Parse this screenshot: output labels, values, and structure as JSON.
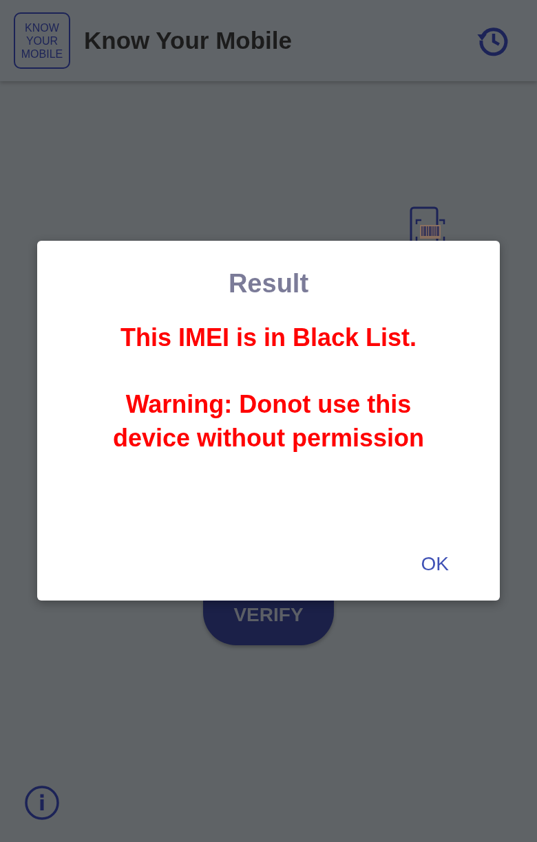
{
  "app_bar": {
    "logo_lines": [
      "KNOW",
      "YOUR",
      "MOBILE"
    ],
    "title": "Know Your Mobile"
  },
  "verify_button": {
    "label": "VERIFY"
  },
  "dialog": {
    "title": "Result",
    "messages": [
      "This IMEI is in Black List.",
      "Warning: Donot use this device without permission"
    ],
    "buttons": [
      "OK"
    ]
  }
}
